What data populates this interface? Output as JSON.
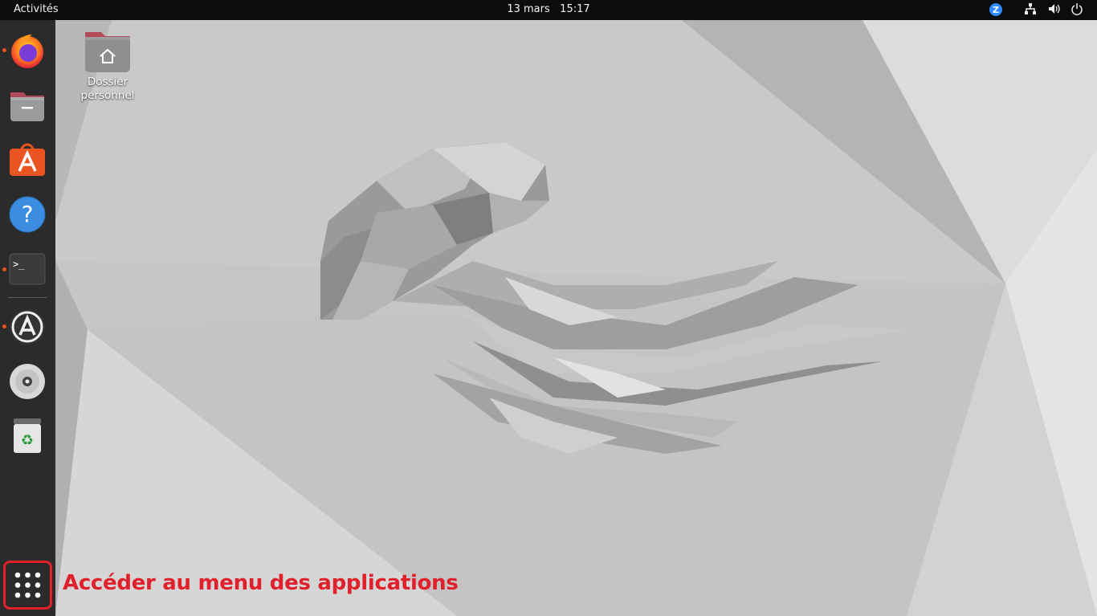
{
  "topbar": {
    "activities": "Activités",
    "date": "13 mars",
    "time": "15:17",
    "tray": {
      "icons": [
        "zoom-tray-icon",
        "network-icon",
        "volume-icon",
        "power-icon"
      ]
    }
  },
  "dock": {
    "items": [
      {
        "name": "firefox",
        "icon": "firefox-icon",
        "running": true
      },
      {
        "name": "files",
        "icon": "files-folder-icon",
        "running": false
      },
      {
        "name": "ubuntu-software",
        "icon": "software-store-icon",
        "running": false
      },
      {
        "name": "help",
        "icon": "help-icon",
        "running": false
      },
      {
        "name": "terminal",
        "icon": "terminal-icon",
        "running": true,
        "prompt": ">_"
      },
      {
        "name": "software-updater",
        "icon": "software-updater-icon",
        "running": true
      },
      {
        "name": "optical-disc",
        "icon": "dvd-icon",
        "running": false
      },
      {
        "name": "trash",
        "icon": "trash-icon",
        "running": false
      }
    ],
    "apps_grid_icon": "show-applications-icon"
  },
  "desktop": {
    "home_folder": {
      "label_line1": "Dossier",
      "label_line2": "personnel",
      "icon": "home-folder-icon"
    }
  },
  "annotation": {
    "text": "Accéder au menu des applications",
    "color": "#e0202a"
  },
  "colors": {
    "topbar_bg": "#0c0c0c",
    "dock_bg": "#2b2b2b",
    "accent": "#e95420",
    "highlight": "#e0202a"
  }
}
